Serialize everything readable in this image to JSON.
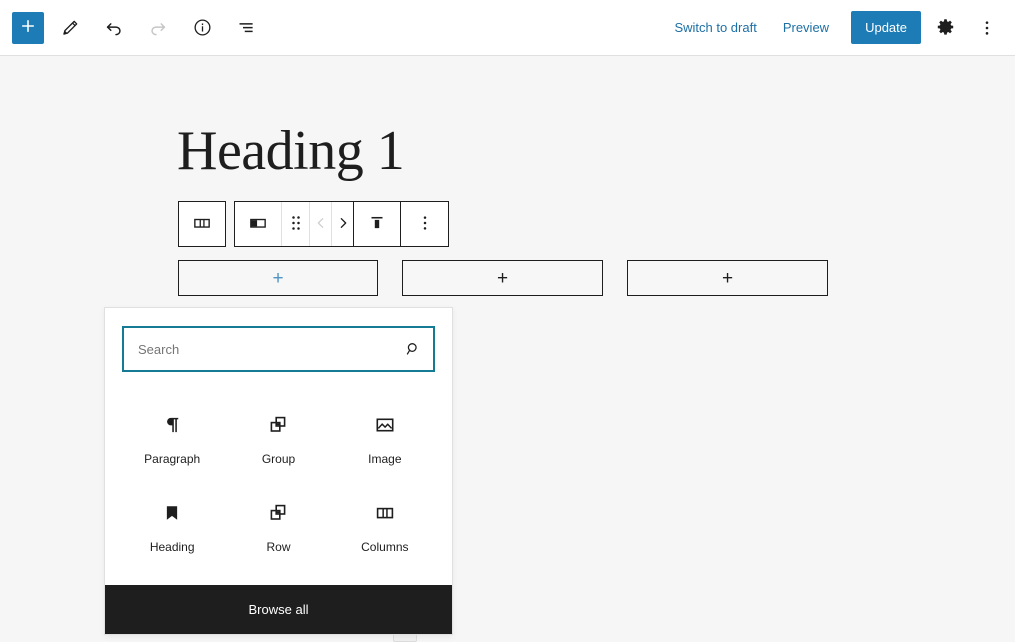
{
  "header": {
    "left_tools": [
      {
        "name": "block-inserter-toggle",
        "icon": "plus-icon",
        "label": "Toggle block inserter"
      },
      {
        "name": "tools-edit-mode",
        "icon": "pencil-icon",
        "label": "Tools"
      },
      {
        "name": "undo-button",
        "icon": "undo-icon",
        "label": "Undo"
      },
      {
        "name": "redo-button",
        "icon": "redo-icon",
        "label": "Redo",
        "disabled": true
      },
      {
        "name": "details-button",
        "icon": "info-icon",
        "label": "Details"
      },
      {
        "name": "list-view-button",
        "icon": "list-view-icon",
        "label": "List View"
      }
    ],
    "switch_to_draft_label": "Switch to draft",
    "preview_label": "Preview",
    "update_label": "Update",
    "settings_icon": "gear-icon",
    "options_icon": "kebab-menu-icon",
    "accent_color": "#1d7cb5",
    "link_color": "#1d6fa5"
  },
  "canvas": {
    "title": "Heading 1",
    "background_color": "#f6f6f6"
  },
  "block_toolbar": {
    "parent_block": {
      "name": "select-parent-columns",
      "icon": "columns-icon",
      "label": "Select Columns"
    },
    "items": [
      {
        "name": "block-type-column",
        "icon": "column-icon",
        "label": "Column"
      },
      {
        "name": "drag-handle",
        "icon": "drag-dots-icon",
        "label": "Drag"
      },
      {
        "name": "move-left-button",
        "icon": "chevron-left-icon",
        "label": "Move left",
        "disabled": true
      },
      {
        "name": "move-right-button",
        "icon": "chevron-right-icon",
        "label": "Move right",
        "disabled": false
      },
      {
        "name": "vertical-align-button",
        "icon": "align-top-icon",
        "label": "Change vertical alignment"
      },
      {
        "name": "block-options-button",
        "icon": "kebab-menu-icon",
        "label": "Options"
      }
    ]
  },
  "columns": [
    {
      "name": "column-appender-1",
      "plus": "+",
      "active": true,
      "plus_color": "#4f94c4"
    },
    {
      "name": "column-appender-2",
      "plus": "+",
      "active": false,
      "plus_color": "#1e1e1e"
    },
    {
      "name": "column-appender-3",
      "plus": "+",
      "active": false,
      "plus_color": "#1e1e1e"
    }
  ],
  "inserter": {
    "search": {
      "placeholder": "Search",
      "value": "",
      "icon": "search-icon",
      "focus_border_color": "#157a94"
    },
    "blocks": [
      {
        "name": "block-paragraph",
        "label": "Paragraph",
        "icon": "pilcrow-icon"
      },
      {
        "name": "block-group",
        "label": "Group",
        "icon": "group-squares-icon"
      },
      {
        "name": "block-image",
        "label": "Image",
        "icon": "image-icon"
      },
      {
        "name": "block-heading",
        "label": "Heading",
        "icon": "bookmark-icon"
      },
      {
        "name": "block-row",
        "label": "Row",
        "icon": "group-squares-icon"
      },
      {
        "name": "block-columns",
        "label": "Columns",
        "icon": "columns-icon"
      }
    ],
    "browse_all_label": "Browse all",
    "browse_all_background": "#1e1e1e"
  }
}
